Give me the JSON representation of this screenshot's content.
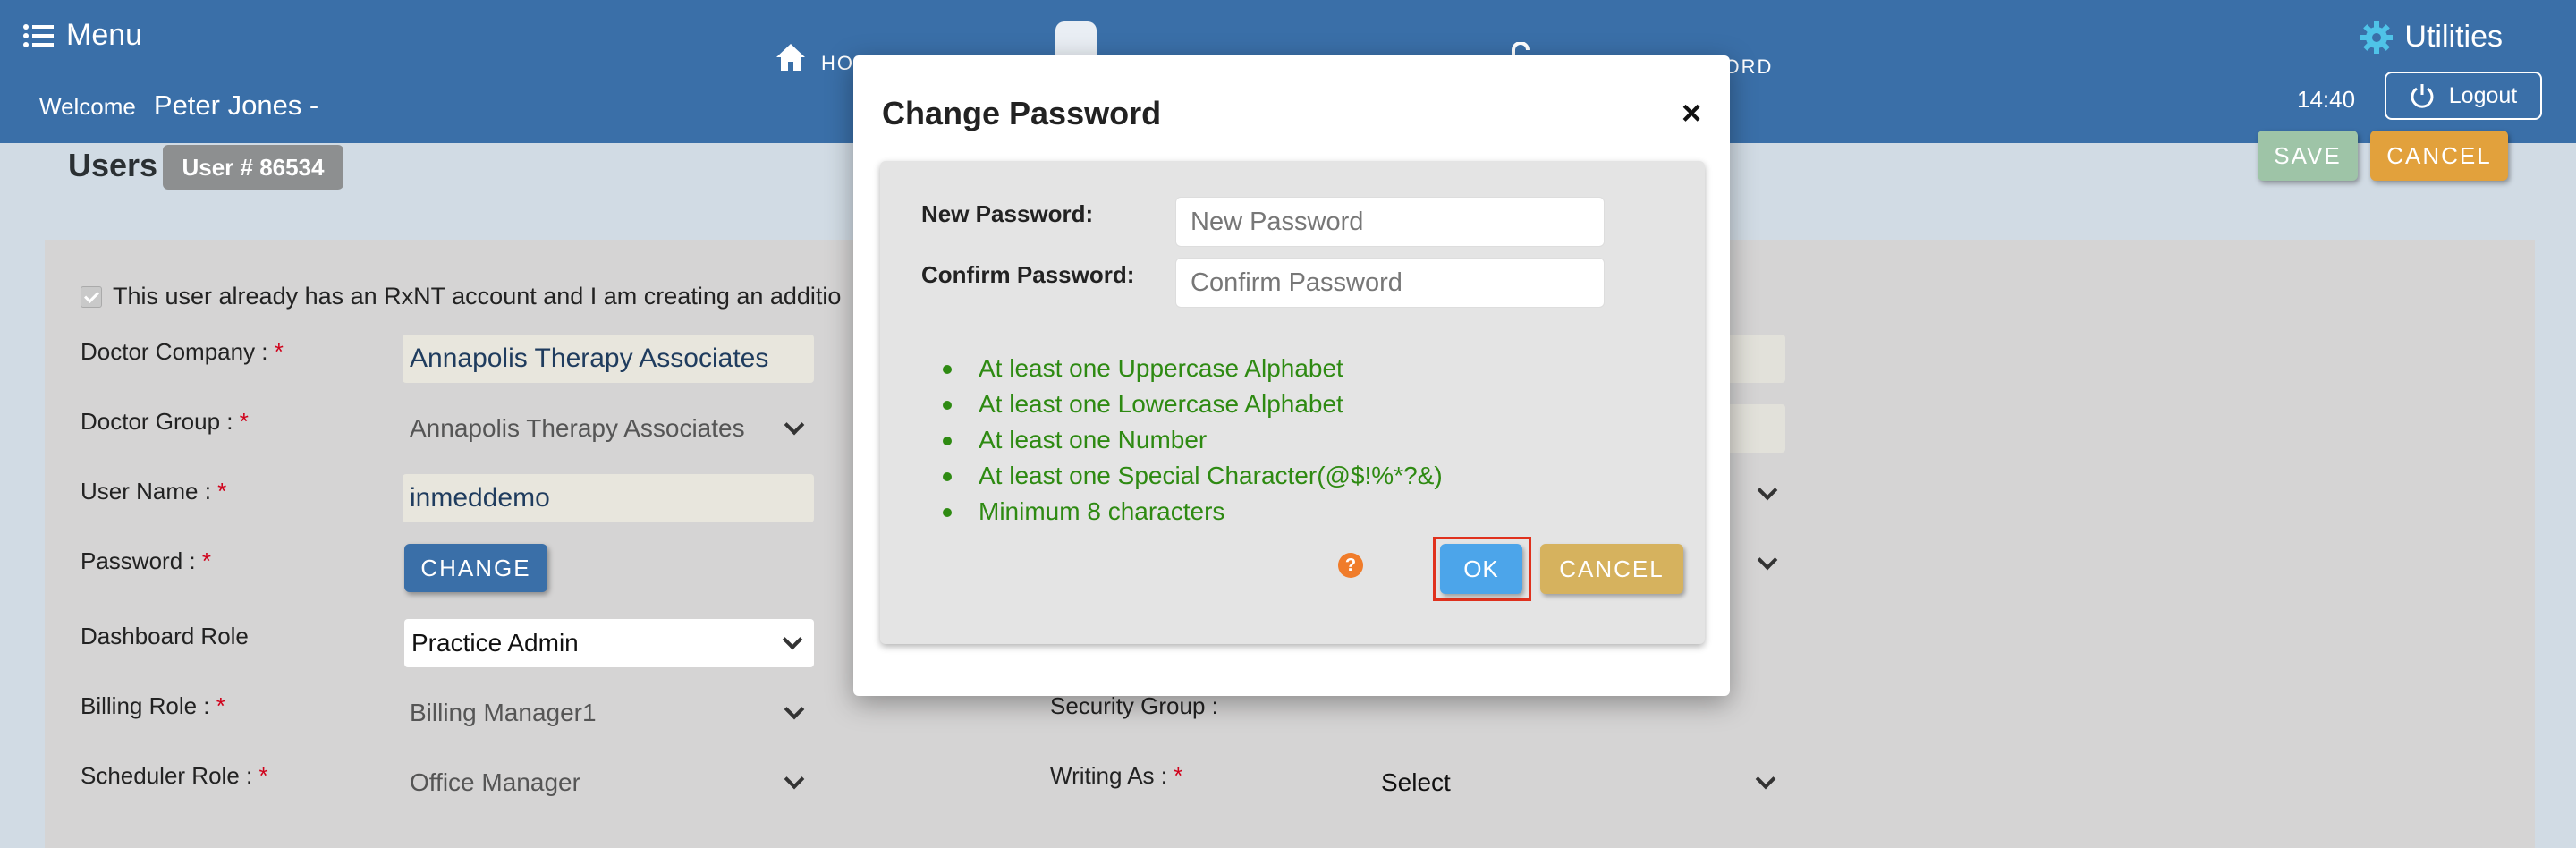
{
  "header": {
    "menu_label": "Menu",
    "welcome_label": "Welcome",
    "user_name": "Peter Jones -",
    "nav_home": "HOME",
    "nav_update_password": "UPDATE PASSWORD",
    "utilities_label": "Utilities",
    "time": "14:40",
    "logout_label": "Logout",
    "brand_color": "#3a6fa8"
  },
  "page": {
    "title": "Users",
    "user_badge": "User # 86534",
    "save_label": "SAVE",
    "cancel_label": "CANCEL",
    "existing_account_text": "This user already has an RxNT account and I am creating an additio"
  },
  "form": {
    "doctor_company_label": "Doctor Company :",
    "doctor_company_value": "Annapolis Therapy Associates",
    "doctor_group_label": "Doctor Group :",
    "doctor_group_value": "Annapolis Therapy Associates",
    "user_name_label": "User Name :",
    "user_name_value": "inmeddemo",
    "password_label": "Password :",
    "change_label": "CHANGE",
    "dashboard_role_label": "Dashboard Role",
    "dashboard_role_value": "Practice Admin",
    "billing_role_label": "Billing Role :",
    "billing_role_value": "Billing Manager1",
    "scheduler_role_label": "Scheduler Role :",
    "scheduler_role_value": "Office Manager",
    "security_group_label": "Security Group :",
    "writing_as_label": "Writing As :",
    "writing_as_value": "Select",
    "required_mark": "*"
  },
  "modal": {
    "title": "Change Password",
    "close_glyph": "×",
    "new_password_label": "New Password:",
    "new_password_placeholder": "New Password",
    "confirm_password_label": "Confirm Password:",
    "confirm_password_placeholder": "Confirm Password",
    "rules": [
      "At least one Uppercase Alphabet",
      "At least one Lowercase Alphabet",
      "At least one Number",
      "At least one Special Character(@$!%*?&)",
      "Minimum 8 characters"
    ],
    "help_glyph": "?",
    "ok_label": "OK",
    "cancel_label": "CANCEL",
    "rule_color": "#2e8a12",
    "ok_color": "#4ca5ea",
    "cancel_color": "#d6b25e",
    "highlight_color": "#e0311d"
  }
}
